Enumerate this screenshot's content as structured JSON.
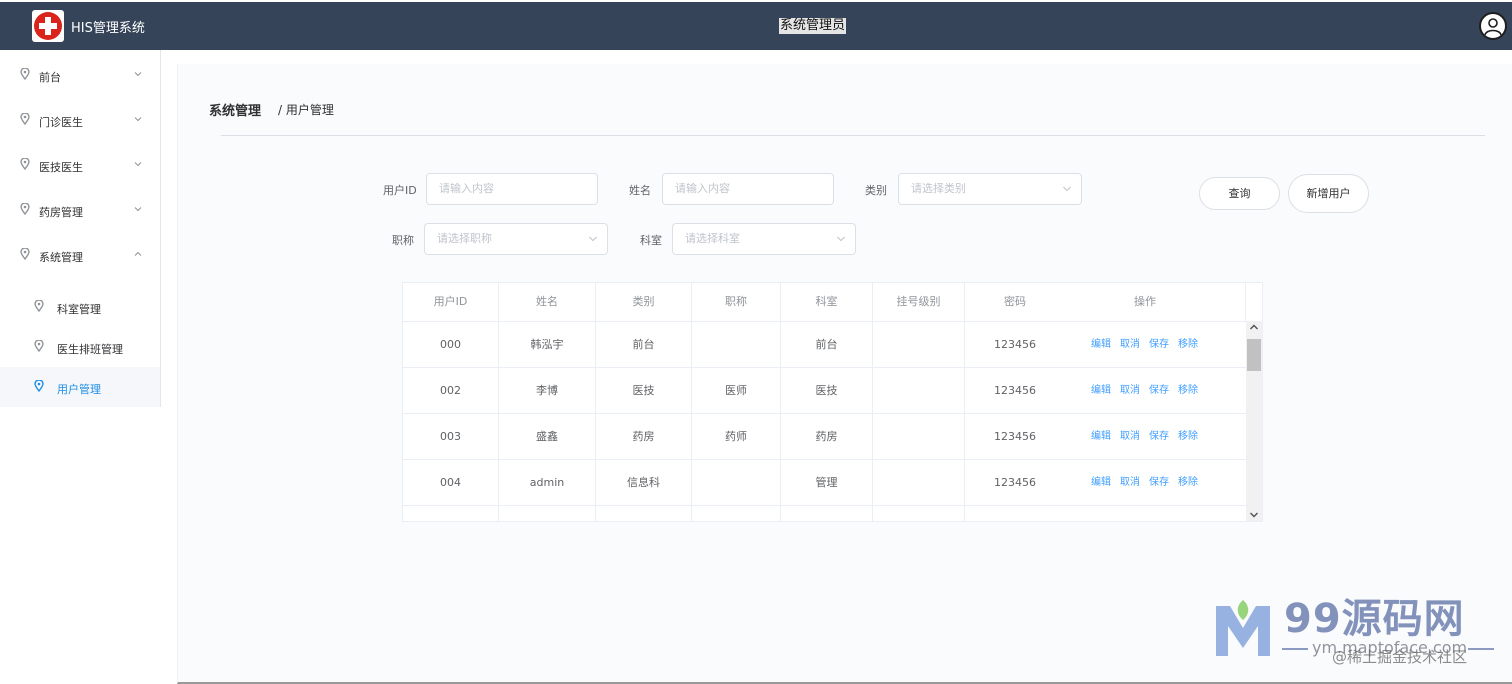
{
  "header": {
    "app_title": "HIS管理系统",
    "user_title": "系统管理员"
  },
  "sidebar": {
    "items": [
      {
        "label": "前台"
      },
      {
        "label": "门诊医生"
      },
      {
        "label": "医技医生"
      },
      {
        "label": "药房管理"
      },
      {
        "label": "系统管理"
      }
    ],
    "subitems": [
      {
        "label": "科室管理"
      },
      {
        "label": "医生排班管理"
      },
      {
        "label": "用户管理"
      }
    ]
  },
  "breadcrumb": {
    "parent": "系统管理",
    "current": "/ 用户管理"
  },
  "filters": {
    "user_id": {
      "label": "用户ID",
      "placeholder": "请输入内容"
    },
    "name": {
      "label": "姓名",
      "placeholder": "请输入内容"
    },
    "type": {
      "label": "类别",
      "placeholder": "请选择类别"
    },
    "title": {
      "label": "职称",
      "placeholder": "请选择职称"
    },
    "dept": {
      "label": "科室",
      "placeholder": "请选择科室"
    },
    "query_button": "查询",
    "add_button": "新增用户"
  },
  "table": {
    "headers": [
      "用户ID",
      "姓名",
      "类别",
      "职称",
      "科室",
      "挂号级别",
      "密码",
      "操作"
    ],
    "rows": [
      [
        "000",
        "韩泓宇",
        "前台",
        "",
        "前台",
        "",
        "123456"
      ],
      [
        "002",
        "李博",
        "医技",
        "医师",
        "医技",
        "",
        "123456"
      ],
      [
        "003",
        "盛鑫",
        "药房",
        "药师",
        "药房",
        "",
        "123456"
      ],
      [
        "004",
        "admin",
        "信息科",
        "",
        "管理",
        "",
        "123456"
      ]
    ],
    "actions": [
      "编辑",
      "取消",
      "保存",
      "移除"
    ]
  },
  "watermark": {
    "brand": "99源码网",
    "url": "ym.maptoface.com",
    "credit": "@稀土掘金技术社区"
  },
  "colors": {
    "header_bg": "#364459",
    "link": "#409eff",
    "active": "#1e8fe6"
  }
}
